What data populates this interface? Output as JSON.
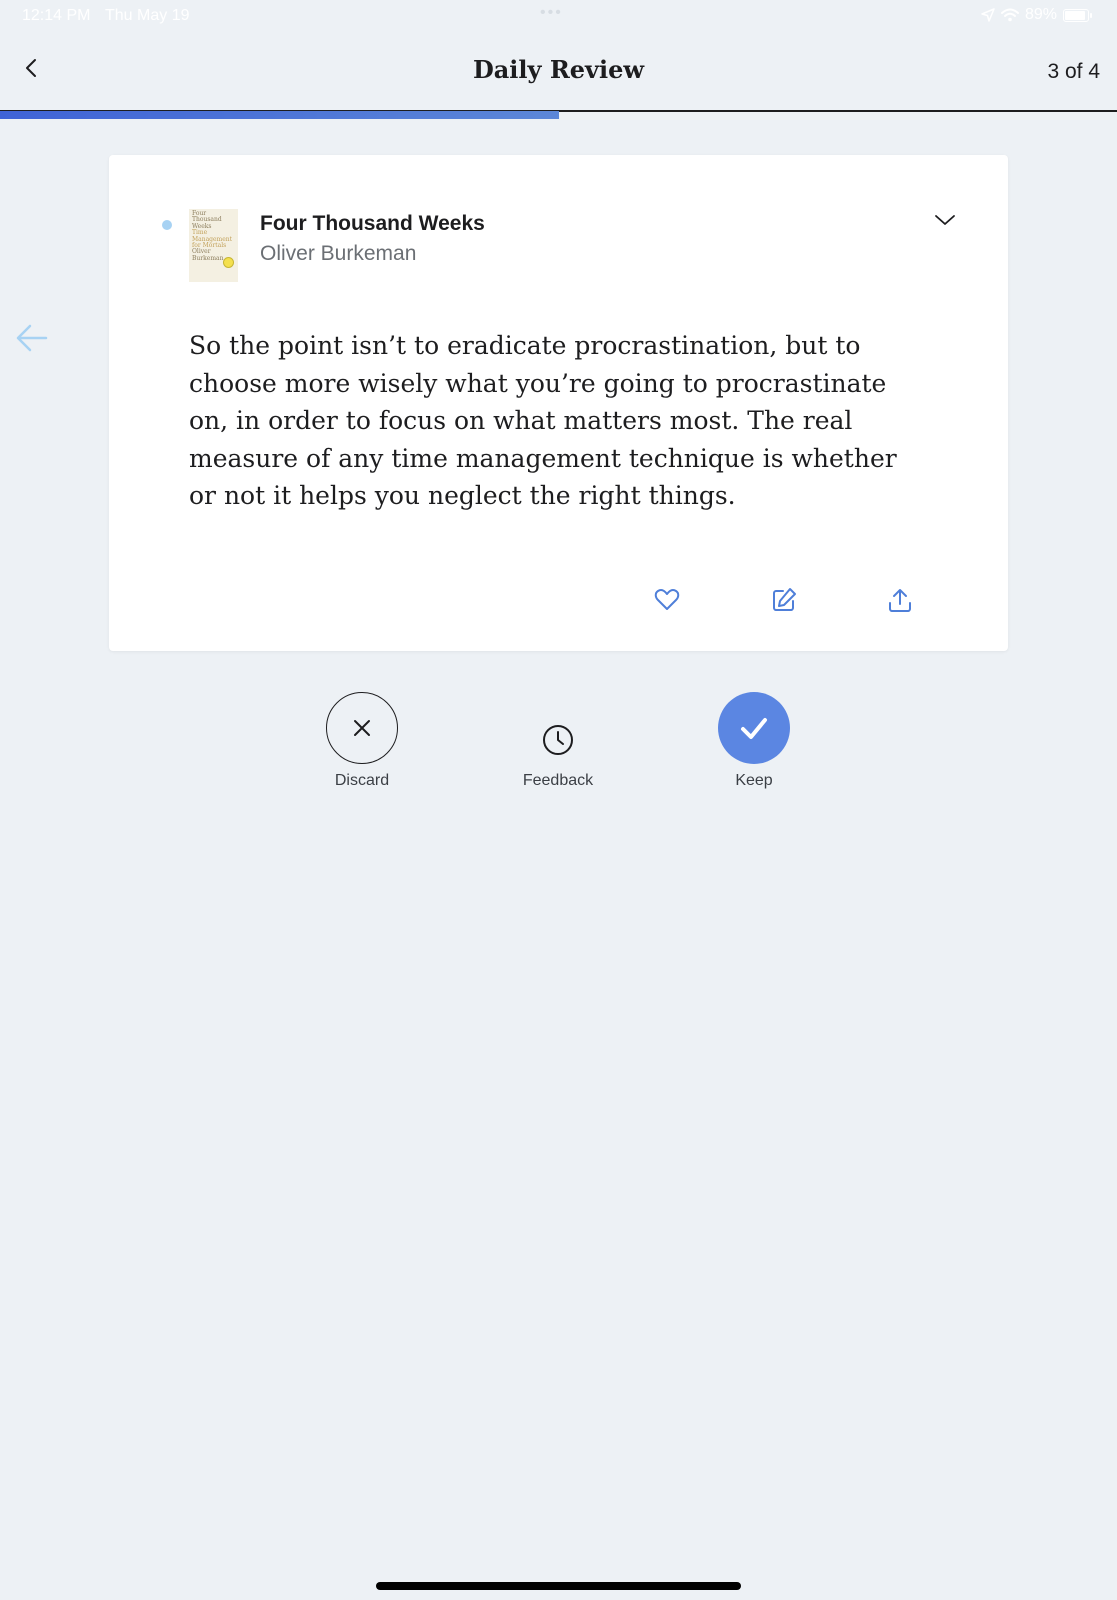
{
  "status_bar": {
    "time": "12:14 PM",
    "date": "Thu May 19",
    "dots": "•••",
    "battery": "89%",
    "battery_level": 0.89
  },
  "nav": {
    "title": "Daily Review",
    "counter": "3 of 4",
    "progress_fraction": 0.5
  },
  "card": {
    "book": {
      "title": "Four Thousand Weeks",
      "author": "Oliver Burkeman",
      "cover_lines": [
        "Four",
        "Thousand",
        "Weeks",
        "Time",
        "Management",
        "for Mortals",
        "Oliver",
        "Burkeman"
      ]
    },
    "highlight": "So the point isn’t to eradicate procrastination, but to choose more wisely what you’re going to procrastinate on, in order to focus on what matters most. The real measure of any time management technique is whether or not it helps you neglect the right things.",
    "actions": {
      "favorite_icon": "heart-icon",
      "edit_icon": "edit-icon",
      "share_icon": "share-icon"
    }
  },
  "review_actions": {
    "discard": "Discard",
    "feedback": "Feedback",
    "keep": "Keep"
  },
  "colors": {
    "background": "#edf1f5",
    "accent": "#5b86e2",
    "progress": "#3f63d6",
    "unread_dot": "#a7d2f3"
  }
}
